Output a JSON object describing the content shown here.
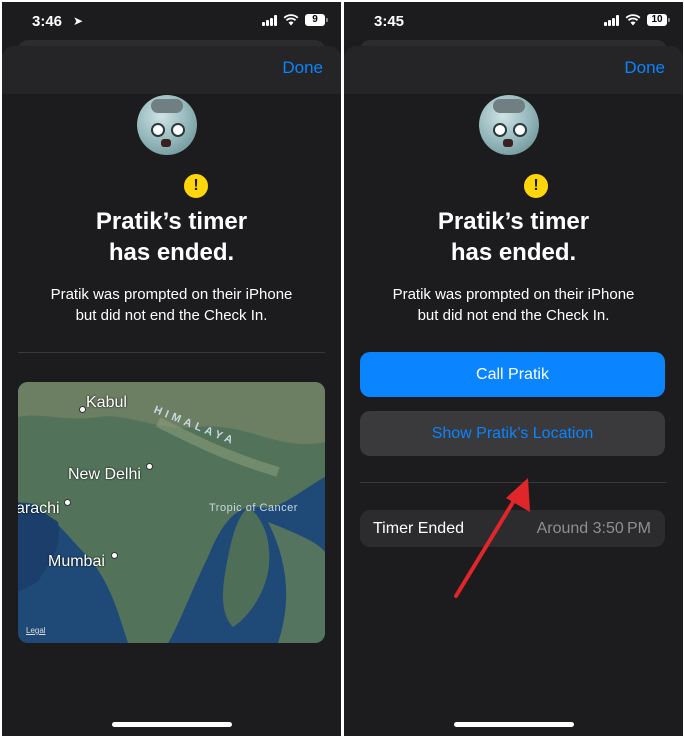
{
  "left": {
    "status": {
      "time": "3:46",
      "battery": "9"
    },
    "done_label": "Done",
    "title_line1": "Pratik’s timer",
    "title_line2": "has ended.",
    "desc_line1": "Pratik was prompted on their iPhone",
    "desc_line2": "but did not end the Check In.",
    "map": {
      "labels": [
        "Kabul",
        "New Delhi",
        "arachi",
        "Mumbai"
      ],
      "small_labels": [
        "HIMALAYA",
        "Tropic of Cancer"
      ],
      "legal": "Legal"
    }
  },
  "right": {
    "status": {
      "time": "3:45",
      "battery": "10"
    },
    "done_label": "Done",
    "title_line1": "Pratik’s timer",
    "title_line2": "has ended.",
    "desc_line1": "Pratik was prompted on their iPhone",
    "desc_line2": "but did not end the Check In.",
    "call_label": "Call Pratik",
    "location_label": "Show Pratik’s Location",
    "timer_row": {
      "label": "Timer Ended",
      "value": "Around 3:50 PM"
    }
  },
  "colors": {
    "accent": "#0a84ff",
    "background": "#1c1c1e",
    "badge": "#ffd60a",
    "annotation_arrow": "#e0262a"
  }
}
